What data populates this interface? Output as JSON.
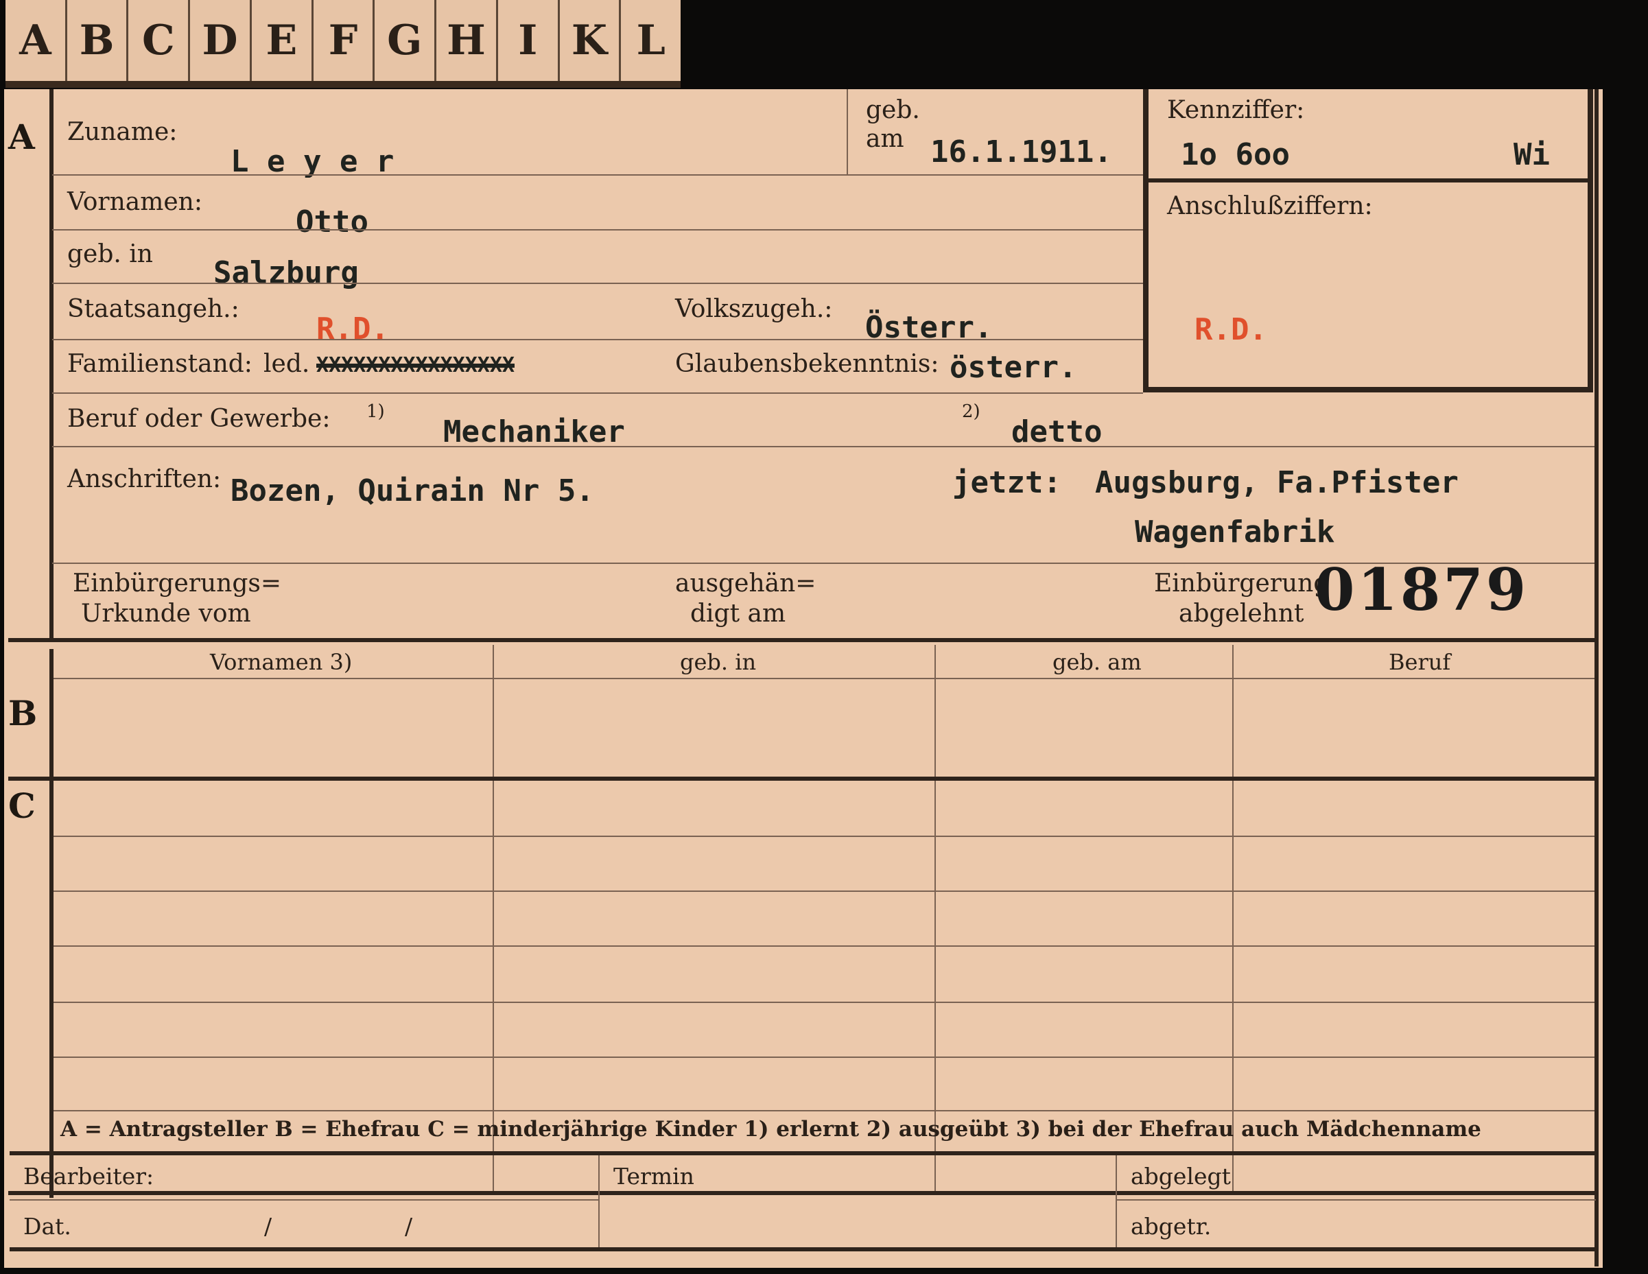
{
  "tabs": [
    "A",
    "B",
    "C",
    "D",
    "E",
    "F",
    "G",
    "H",
    "I",
    "K",
    "L"
  ],
  "section_letters": {
    "a": "A",
    "b": "B",
    "c": "C"
  },
  "labels": {
    "zuname": "Zuname:",
    "geb": "geb.",
    "am": "am",
    "kennziffer": "Kennziffer:",
    "vornamen": "Vornamen:",
    "anschlussziffern": "Anschlußziffern:",
    "geb_in": "geb. in",
    "staatsangeh": "Staatsangeh.:",
    "volkszugeh": "Volkszugeh.:",
    "familienstand": "Familienstand:",
    "familienstand_value": "led.",
    "glaubensbekenntnis": "Glaubensbekenntnis:",
    "beruf": "Beruf oder Gewerbe:",
    "fn1": "1)",
    "fn2": "2)",
    "anschriften": "Anschriften:",
    "einbuergerungs_line1": "Einbürgerungs=",
    "einbuergerungs_line2": "Urkunde vom",
    "ausgehaen_line1": "ausgehän=",
    "ausgehaen_line2": "digt am",
    "abgelehnt_line1": "Einbürgerung",
    "abgelehnt_line2": "abgelehnt"
  },
  "values": {
    "zuname": "L e y e r",
    "geb_am": "16.1.1911.",
    "kennziffer": "1o 6oo",
    "kennziffer_suffix": "Wi",
    "vornamen": "Otto",
    "geb_in": "Salzburg",
    "staatsangeh": "R.D.",
    "volkszugeh": "Österr.",
    "familienstand_crossed": "XXXXXXXXXXXXXXXX",
    "glaubensbekenntnis": "österr.",
    "anschlussziffern": "R.D.",
    "beruf_erlernt": "Mechaniker",
    "beruf_ausgeuebt": "detto",
    "anschrift": "Bozen, Quirain Nr  5.",
    "jetzt_label": "jetzt:",
    "jetzt_value": "Augsburg, Fa.Pfister",
    "jetzt_value2": "Wagenfabrik",
    "stamp_number": "01879"
  },
  "table_headers": [
    "Vornamen 3)",
    "geb. in",
    "geb. am",
    "Beruf"
  ],
  "legend": "A = Antragsteller   B = Ehefrau   C = minderjährige Kinder   1) erlernt   2) ausgeübt   3) bei der Ehefrau auch Mädchenname",
  "footer": {
    "bearbeiter": "Bearbeiter:",
    "dat": "Dat.",
    "slash1": "/",
    "slash2": "/",
    "termin": "Termin",
    "abgelegt": "abgelegt",
    "abgetr": "abgetr."
  },
  "colors": {
    "card": "#ecc9ac",
    "background": "#0b0a09",
    "rule": "#2e231b",
    "red_stamp": "#e0502c"
  }
}
